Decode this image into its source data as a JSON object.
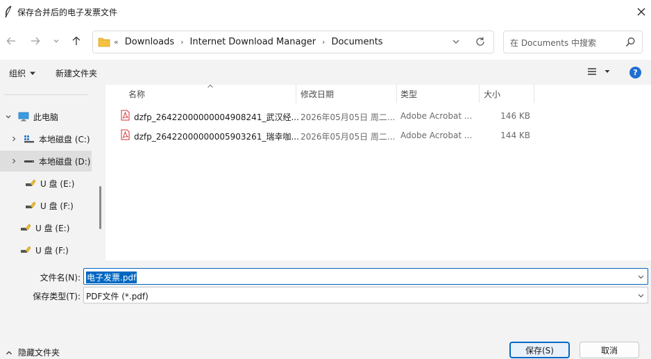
{
  "window": {
    "title": "保存合并后的电子发票文件"
  },
  "address": {
    "overflow": "«",
    "crumbs": [
      "Downloads",
      "Internet Download Manager",
      "Documents"
    ]
  },
  "search": {
    "placeholder": "在 Documents 中搜索"
  },
  "toolbar": {
    "organize_label": "组织",
    "new_folder_label": "新建文件夹"
  },
  "nav": {
    "items": [
      {
        "label": "此电脑",
        "icon": "pc-icon",
        "chevron": "down"
      },
      {
        "label": "本地磁盘 (C:)",
        "icon": "windows-drive-icon",
        "chevron": "right"
      },
      {
        "label": "本地磁盘 (D:)",
        "icon": "drive-icon",
        "chevron": "right",
        "selected": true
      },
      {
        "label": "U 盘 (E:)",
        "icon": "usb-drive-icon"
      },
      {
        "label": "U 盘 (F:)",
        "icon": "usb-drive-icon"
      },
      {
        "label": "U 盘 (E:)",
        "icon": "usb-drive-icon"
      },
      {
        "label": "U 盘 (F:)",
        "icon": "usb-drive-icon"
      }
    ]
  },
  "columns": {
    "name": "名称",
    "date": "修改日期",
    "type": "类型",
    "size": "大小"
  },
  "files": [
    {
      "name": "dzfp_26422000000004908241_武汉经...",
      "date": "2026年05月05日 周二...",
      "type": "Adobe Acrobat ...",
      "size": "146 KB"
    },
    {
      "name": "dzfp_26422000000005903261_瑞幸咖...",
      "date": "2026年05月05日 周二...",
      "type": "Adobe Acrobat ...",
      "size": "144 KB"
    }
  ],
  "form": {
    "filename_label": "文件名(N):",
    "filename_value": "电子发票.pdf",
    "filetype_label": "保存类型(T):",
    "filetype_value": "PDF文件 (*.pdf)"
  },
  "footer": {
    "hide_folders_label": "隐藏文件夹",
    "save_label": "保存(S)",
    "cancel_label": "取消"
  },
  "colors": {
    "accent": "#0067c0",
    "help": "#1f6fd1",
    "pdf": "#d32f2f",
    "folder": "#f5c242"
  }
}
